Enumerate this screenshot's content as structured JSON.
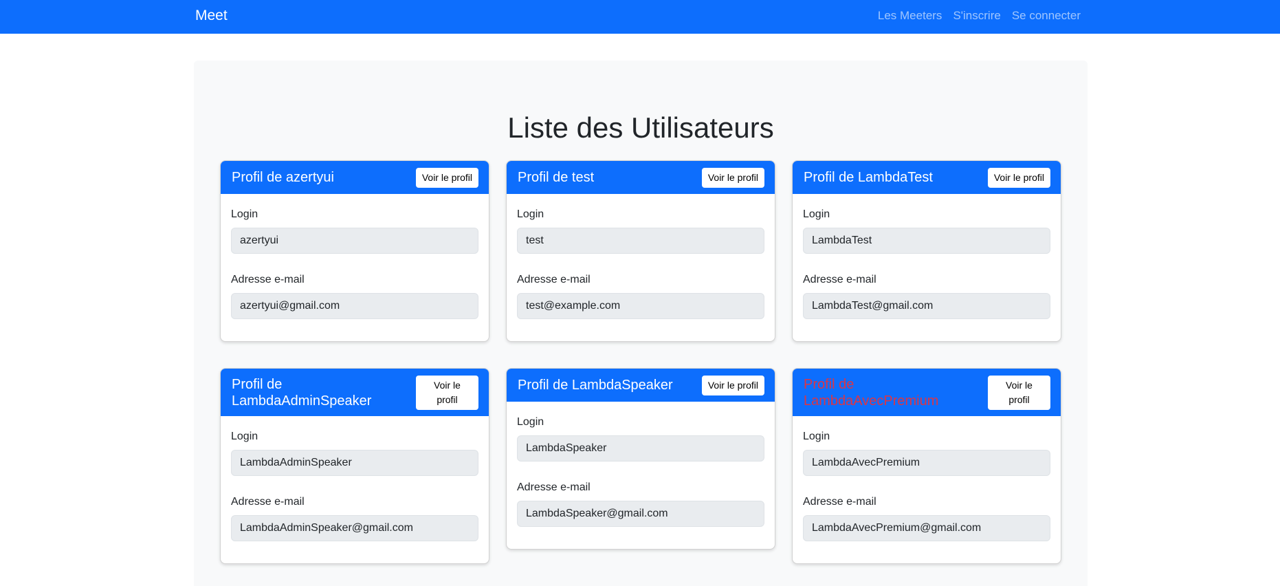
{
  "navbar": {
    "brand": "Meet",
    "links": [
      "Les Meeters",
      "S'inscrire",
      "Se connecter"
    ]
  },
  "page": {
    "title": "Liste des Utilisateurs"
  },
  "labels": {
    "login": "Login",
    "email": "Adresse e-mail"
  },
  "cards": [
    {
      "title": "Profil de azertyui",
      "button": "Voir le profil",
      "login": "azertyui",
      "email": "azertyui@gmail.com"
    },
    {
      "title": "Profil de test",
      "button": "Voir le profil",
      "login": "test",
      "email": "test@example.com"
    },
    {
      "title": "Profil de LambdaTest",
      "button": "Voir le profil",
      "login": "LambdaTest",
      "email": "LambdaTest@gmail.com"
    },
    {
      "title": "Profil de LambdaAdminSpeaker",
      "button": "Voir le profil",
      "login": "LambdaAdminSpeaker",
      "email": "LambdaAdminSpeaker@gmail.com"
    },
    {
      "title": "Profil de LambdaSpeaker",
      "button": "Voir le profil",
      "login": "LambdaSpeaker",
      "email": "LambdaSpeaker@gmail.com"
    },
    {
      "title": "Profil de LambdaAvecPremium",
      "button": "Voir le profil",
      "login": "LambdaAvecPremium",
      "email": "LambdaAvecPremium@gmail.com",
      "title_color": "#dc3545"
    }
  ],
  "colors": {
    "primary": "#0d6efd",
    "danger": "#dc3545",
    "field_bg": "#e9ecef",
    "container_bg": "#f8f9fa"
  }
}
